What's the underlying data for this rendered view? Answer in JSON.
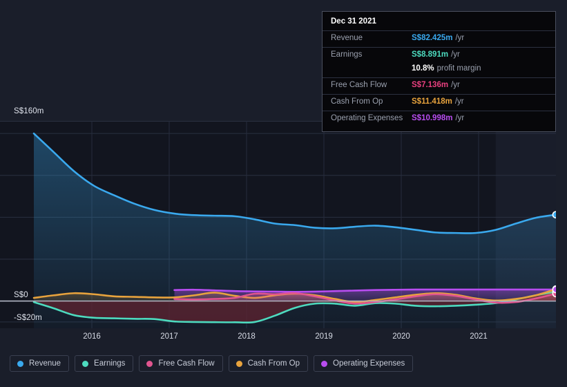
{
  "axes": {
    "y_top_label": "S$160m",
    "y_zero_label": "S$0",
    "y_neg_label": "-S$20m",
    "x_labels": [
      "2016",
      "2017",
      "2018",
      "2019",
      "2020",
      "2021"
    ]
  },
  "tooltip": {
    "date": "Dec 31 2021",
    "rows": [
      {
        "label": "Revenue",
        "value": "S$82.425m",
        "suffix": "/yr",
        "color": "#3aa9ee"
      },
      {
        "label": "Earnings",
        "value": "S$8.891m",
        "suffix": "/yr",
        "color": "#4ddbbf"
      },
      {
        "label": "",
        "value": "10.8%",
        "suffix": "profit margin",
        "color": "#ffffff"
      },
      {
        "label": "Free Cash Flow",
        "value": "S$7.136m",
        "suffix": "/yr",
        "color": "#e8407f"
      },
      {
        "label": "Cash From Op",
        "value": "S$11.418m",
        "suffix": "/yr",
        "color": "#e8a33d"
      },
      {
        "label": "Operating Expenses",
        "value": "S$10.998m",
        "suffix": "/yr",
        "color": "#b84df0"
      }
    ]
  },
  "legend": [
    {
      "label": "Revenue",
      "color": "#3aa9ee"
    },
    {
      "label": "Earnings",
      "color": "#4ddbbf"
    },
    {
      "label": "Free Cash Flow",
      "color": "#e0558f"
    },
    {
      "label": "Cash From Op",
      "color": "#e8a33d"
    },
    {
      "label": "Operating Expenses",
      "color": "#b84df0"
    }
  ],
  "chart_data": {
    "type": "area",
    "title": "",
    "xlabel": "",
    "ylabel": "S$",
    "currency": "S$",
    "unit": "m",
    "ylim": [
      -26,
      172
    ],
    "ytick_values": [
      160,
      0,
      -20
    ],
    "ytick_labels": [
      "S$160m",
      "S$0",
      "-S$20m"
    ],
    "xlim": [
      "2015-06",
      "2022-03"
    ],
    "x": [
      "2015-06",
      "2015-09",
      "2015-12",
      "2016-03",
      "2016-06",
      "2016-09",
      "2016-12",
      "2017-03",
      "2017-06",
      "2017-09",
      "2017-12",
      "2018-03",
      "2018-06",
      "2018-09",
      "2018-12",
      "2019-03",
      "2019-06",
      "2019-09",
      "2019-12",
      "2020-03",
      "2020-06",
      "2020-09",
      "2020-12",
      "2021-03",
      "2021-06",
      "2021-09",
      "2021-12"
    ],
    "grid": true,
    "legend_position": "bottom",
    "highlight_region": {
      "from": "2021-03",
      "to": "2021-12",
      "label": "Dec 31 2021"
    },
    "series": [
      {
        "name": "Revenue",
        "color": "#3aa9ee",
        "values": [
          160.0,
          142.0,
          124.0,
          110.0,
          101.0,
          93.0,
          87.0,
          83.5,
          82.0,
          81.5,
          81.0,
          78.0,
          74.0,
          72.5,
          70.0,
          69.5,
          71.0,
          72.0,
          70.5,
          68.0,
          65.5,
          65.0,
          65.0,
          68.0,
          74.0,
          79.5,
          82.425
        ]
      },
      {
        "name": "Earnings",
        "color": "#4ddbbf",
        "values": [
          -1.0,
          -7.0,
          -13.5,
          -16.0,
          -16.5,
          -17.0,
          -17.2,
          -19.5,
          -20.0,
          -20.2,
          -20.3,
          -20.0,
          -14.0,
          -6.5,
          -2.5,
          -2.5,
          -4.5,
          -2.0,
          -2.5,
          -4.5,
          -5.0,
          -4.5,
          -3.5,
          -2.0,
          1.5,
          5.5,
          8.891
        ]
      },
      {
        "name": "Free Cash Flow",
        "color": "#e0558f",
        "values": [
          null,
          null,
          null,
          null,
          null,
          null,
          null,
          2.0,
          1.5,
          2.0,
          3.0,
          7.0,
          6.5,
          7.5,
          4.5,
          0.5,
          -2.5,
          -1.0,
          1.5,
          4.5,
          6.5,
          5.0,
          1.5,
          -1.5,
          -1.0,
          2.5,
          7.136
        ]
      },
      {
        "name": "Cash From Op",
        "color": "#e8a33d",
        "values": [
          3.0,
          5.5,
          7.5,
          6.5,
          4.5,
          4.0,
          3.5,
          3.5,
          5.5,
          8.0,
          5.0,
          3.0,
          5.5,
          7.0,
          5.5,
          2.0,
          -1.0,
          1.0,
          3.5,
          6.0,
          7.5,
          6.0,
          2.5,
          0.5,
          2.0,
          5.5,
          11.418
        ]
      },
      {
        "name": "Operating Expenses",
        "color": "#b84df0",
        "values": [
          null,
          null,
          null,
          null,
          null,
          null,
          null,
          10.5,
          10.8,
          10.2,
          9.5,
          9.2,
          9.0,
          8.8,
          9.0,
          9.5,
          10.0,
          10.5,
          10.8,
          11.0,
          11.0,
          11.0,
          11.0,
          11.0,
          11.0,
          11.0,
          10.998
        ]
      }
    ]
  }
}
